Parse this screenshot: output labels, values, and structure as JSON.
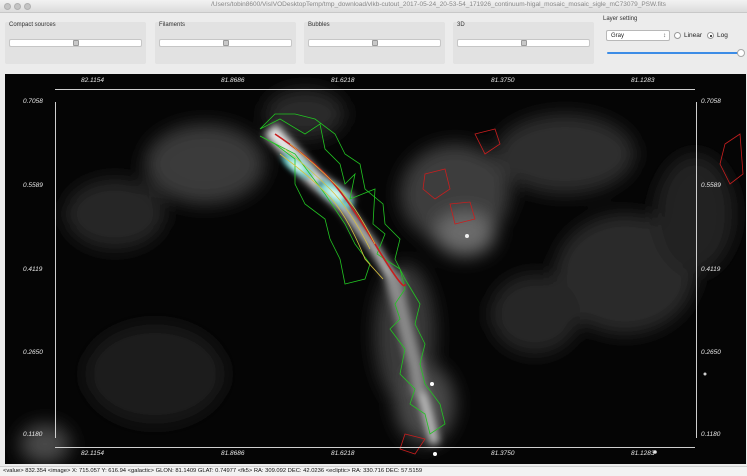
{
  "window": {
    "title": "/Users/tobin8600/VisIVODesktopTemp/tmp_download/vlkb-cutout_2017-05-24_20-53-54_171926_continuum-higal_mosaic_mosaic_sigle_mC73079_PSW.fits"
  },
  "panels": [
    {
      "label": "Compact sources",
      "slider_value": 0.5
    },
    {
      "label": "Filaments",
      "slider_value": 0.5
    },
    {
      "label": "Bubbles",
      "slider_value": 0.5
    },
    {
      "label": "3D",
      "slider_value": 0.5
    }
  ],
  "layer_setting": {
    "label": "Layer setting",
    "colormap": "Gray",
    "options": [
      "Linear",
      "Log"
    ],
    "selected": "Log",
    "slider_value": 1.0
  },
  "image": {
    "x_ticks_top": [
      "82.1154",
      "81.8686",
      "81.6218",
      "81.3750",
      "81.1283"
    ],
    "x_ticks_bottom": [
      "82.1154",
      "81.8686",
      "81.6218",
      "81.3750",
      "81.1283"
    ],
    "y_ticks_left": [
      "0.7058",
      "0.5589",
      "0.4119",
      "0.2650",
      "0.1180"
    ],
    "y_ticks_right": [
      "0.7058",
      "0.5589",
      "0.4119",
      "0.2650",
      "0.1180"
    ]
  },
  "status": {
    "text": "<value> 832.354 <image> X: 715.057 Y: 616.94 <galactic> GLON: 81.1409 GLAT: 0.74977 <fk5> RA: 309.092 DEC: 42.0236 <ecliptic> RA: 330.716 DEC: 57.5159"
  },
  "colors": {
    "contour_green": "#22c422",
    "contour_red": "#c81e1e",
    "contour_yellow": "#d8c040",
    "slider_blue": "#3c8ce6"
  }
}
